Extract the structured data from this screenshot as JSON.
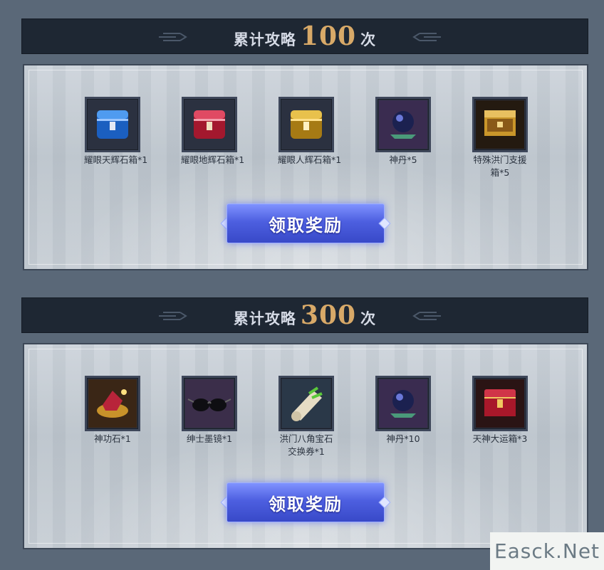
{
  "sections": [
    {
      "title_prefix": "累计攻略",
      "count": "100",
      "title_suffix": "次",
      "items": [
        {
          "icon": "blue-chest-icon",
          "label": "耀眼天辉石箱*1"
        },
        {
          "icon": "red-chest-icon",
          "label": "耀眼地辉石箱*1"
        },
        {
          "icon": "gold-chest-icon",
          "label": "耀眼人辉石箱*1"
        },
        {
          "icon": "dark-orb-icon",
          "label": "神丹*5"
        },
        {
          "icon": "gold-treasure-box-icon",
          "label": "特殊洪门支援箱*5"
        }
      ],
      "button_label": "领取奖励"
    },
    {
      "title_prefix": "累计攻略",
      "count": "300",
      "title_suffix": "次",
      "items": [
        {
          "icon": "gold-gem-icon",
          "label": "神功石*1"
        },
        {
          "icon": "sunglasses-icon",
          "label": "绅士墨镜*1"
        },
        {
          "icon": "scroll-icon",
          "label": "洪门八角宝石交换券*1"
        },
        {
          "icon": "dark-orb-icon",
          "label": "神丹*10"
        },
        {
          "icon": "red-treasure-box-icon",
          "label": "天神大运箱*3"
        }
      ],
      "button_label": "领取奖励"
    }
  ],
  "watermark": "Easck.Net"
}
